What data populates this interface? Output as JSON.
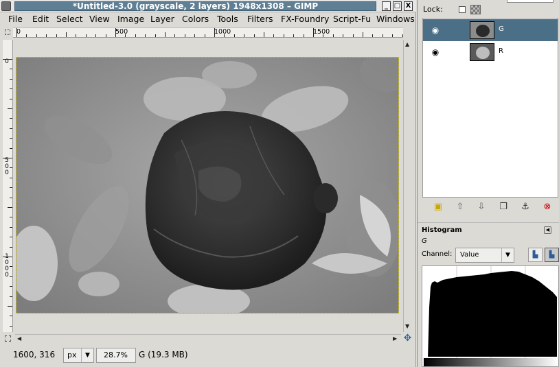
{
  "window": {
    "title": "*Untitled-3.0 (grayscale, 2 layers) 1948x1308 – GIMP",
    "buttons": {
      "minimize": "_",
      "maximize": "□",
      "close": "X"
    }
  },
  "menubar": {
    "items": [
      "File",
      "Edit",
      "Select",
      "View",
      "Image",
      "Layer",
      "Colors",
      "Tools",
      "Filters",
      "FX-Foundry",
      "Script-Fu",
      "Windows"
    ]
  },
  "rulers": {
    "horizontal_labels": [
      "0",
      "500",
      "1000",
      "1500"
    ],
    "vertical_labels": [
      "0",
      "500",
      "1000"
    ]
  },
  "statusbar": {
    "coordinates": "1600, 316",
    "unit": "px",
    "zoom": "28.7%",
    "info": "G (19.3 MB)"
  },
  "layers_panel": {
    "lock_label": "Lock:",
    "layers": [
      {
        "name": "G",
        "visible": true,
        "selected": true
      },
      {
        "name": "R",
        "visible": true,
        "selected": false
      }
    ]
  },
  "histogram": {
    "title": "Histogram",
    "layer_name": "G",
    "channel_label": "Channel:",
    "channel_value": "Value"
  },
  "icons": {
    "eye": "eye-icon",
    "new_layer": "new-layer-icon",
    "raise_layer": "raise-layer-icon",
    "lower_layer": "lower-layer-icon",
    "duplicate_layer": "duplicate-layer-icon",
    "anchor_layer": "anchor-icon",
    "delete_layer": "delete-icon",
    "navigate": "navigate-icon"
  },
  "colors": {
    "title_bar": "#5f7f94",
    "selected_layer": "#4a6f87",
    "selection_border": "#c9b800",
    "delete_icon": "#cc0000"
  }
}
